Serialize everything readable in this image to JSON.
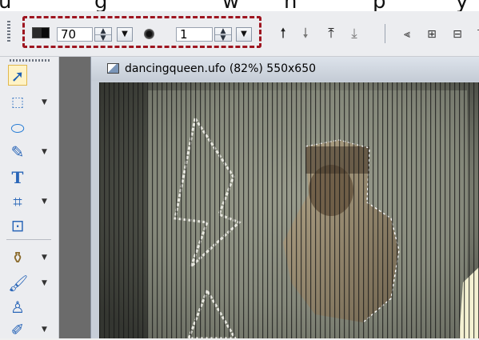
{
  "caption_fragments": [
    "u",
    "g",
    "w",
    "n",
    "p",
    "y"
  ],
  "toolbar": {
    "opacity_value": "70",
    "size_value": "1",
    "spin_up": "▲",
    "spin_down": "▼",
    "dropdown_arrow": "▼",
    "order_buttons": [
      {
        "icon": "move-up-icon",
        "glyph": "🠕"
      },
      {
        "icon": "move-down-icon",
        "glyph": "🠗"
      },
      {
        "icon": "move-to-top-icon",
        "glyph": "⤒"
      },
      {
        "icon": "move-to-bottom-icon",
        "glyph": "⤓"
      }
    ],
    "align_buttons": [
      {
        "icon": "align-left-icon",
        "glyph": "⫷"
      },
      {
        "icon": "align-center-icon",
        "glyph": "⊞"
      },
      {
        "icon": "align-right-icon",
        "glyph": "⊟"
      },
      {
        "icon": "align-top-icon",
        "glyph": "⊤"
      }
    ],
    "highlight_color": "#9e1520"
  },
  "tools": [
    {
      "icon": "pointer-tool-icon",
      "glyph": "➚",
      "selected": true,
      "has_menu": false
    },
    {
      "icon": "selection-tool-icon",
      "glyph": "⬚",
      "selected": false,
      "has_menu": true
    },
    {
      "icon": "shape-tool-icon",
      "glyph": "⬭",
      "selected": false,
      "has_menu": false
    },
    {
      "icon": "pen-tool-icon",
      "glyph": "✎",
      "selected": false,
      "has_menu": true
    },
    {
      "icon": "text-tool-icon",
      "glyph": "T",
      "selected": false,
      "has_menu": false
    },
    {
      "icon": "crop-tool-icon",
      "glyph": "⌗",
      "selected": false,
      "has_menu": true
    },
    {
      "icon": "transform-tool-icon",
      "glyph": "⊡",
      "selected": false,
      "has_menu": false
    },
    {
      "icon": "paint-bucket-tool-icon",
      "glyph": "⚱",
      "selected": false,
      "has_menu": true
    },
    {
      "icon": "brush-tool-icon",
      "glyph": "🖌",
      "selected": false,
      "has_menu": true
    },
    {
      "icon": "clone-stamp-tool-icon",
      "glyph": "♙",
      "selected": false,
      "has_menu": false
    },
    {
      "icon": "eyedropper-tool-icon",
      "glyph": "✐",
      "selected": false,
      "has_menu": true
    }
  ],
  "document": {
    "title": "dancingqueen.ufo (82%) 550x650"
  },
  "colors": {
    "tool_selected_bg": "#fff3c6",
    "panel_bg": "#ecedf0",
    "doc_title_bg": "#c5ccd6"
  }
}
